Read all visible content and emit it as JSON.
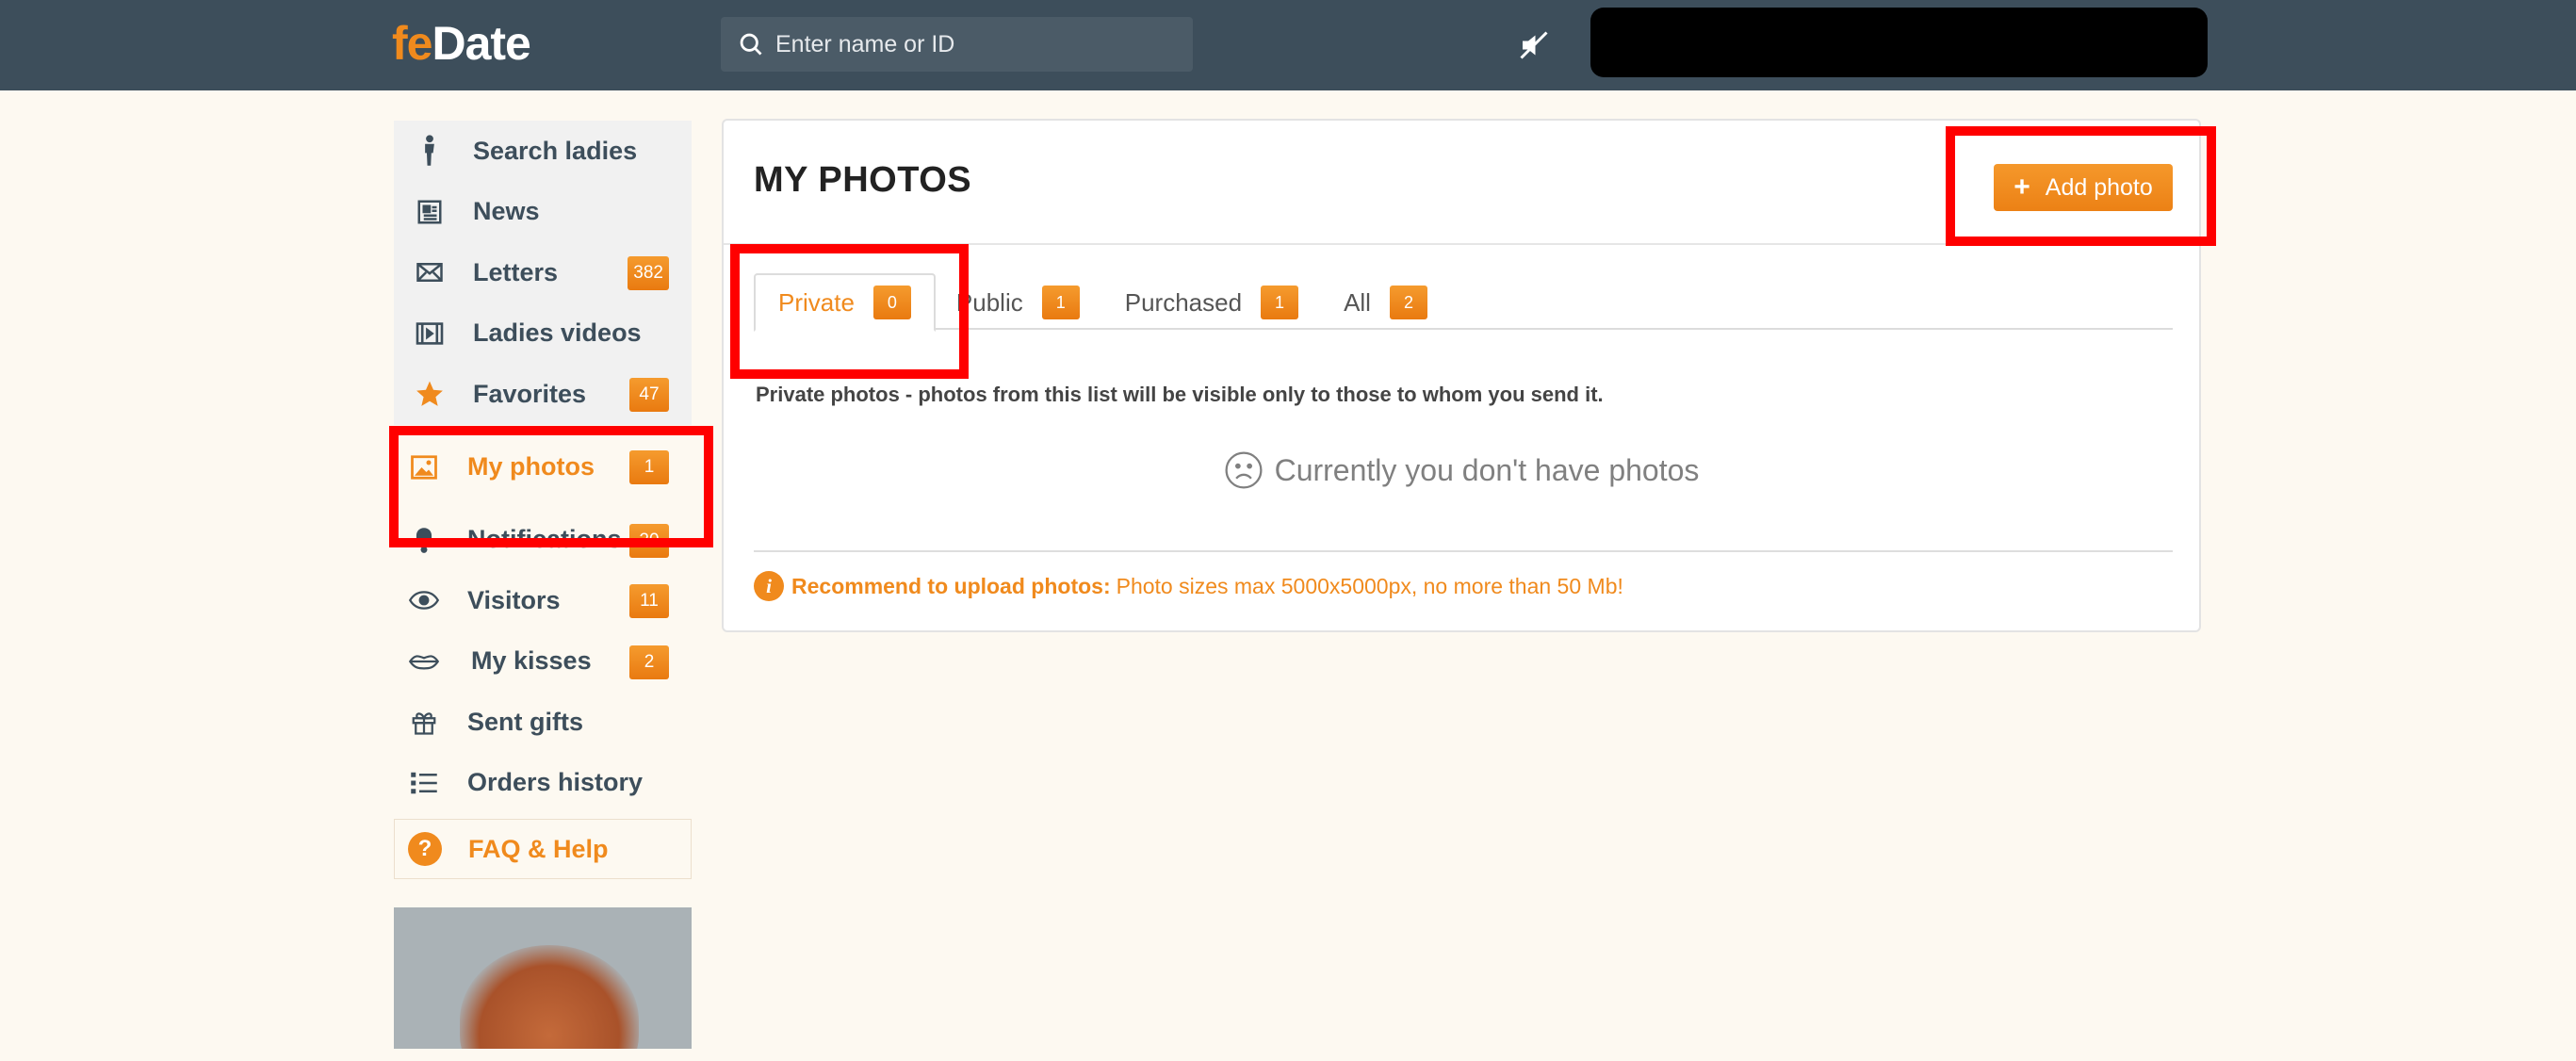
{
  "header": {
    "logo_fe": "fe",
    "logo_date": "Date",
    "search_placeholder": "Enter name or ID"
  },
  "sidebar": {
    "items": [
      {
        "label": "Search ladies",
        "icon": "person-icon"
      },
      {
        "label": "News",
        "icon": "newspaper-icon"
      },
      {
        "label": "Letters",
        "icon": "envelope-icon",
        "badge": "382"
      },
      {
        "label": "Ladies videos",
        "icon": "film-icon"
      },
      {
        "label": "Favorites",
        "icon": "star-icon",
        "badge": "47"
      },
      {
        "label": "My photos",
        "icon": "image-icon",
        "badge": "1",
        "active": true
      },
      {
        "label": "Notifications",
        "icon": "bell-icon",
        "badge": "20"
      },
      {
        "label": "Visitors",
        "icon": "eye-icon",
        "badge": "11"
      },
      {
        "label": "My kisses",
        "icon": "lips-icon",
        "badge": "2"
      },
      {
        "label": "Sent gifts",
        "icon": "gift-icon"
      },
      {
        "label": "Orders history",
        "icon": "list-icon"
      }
    ],
    "faq_label": "FAQ & Help",
    "faq_icon": "?"
  },
  "main": {
    "title": "MY PHOTOS",
    "add_button_label": "Add photo",
    "add_button_plus": "+",
    "tabs": [
      {
        "label": "Private",
        "count": "0",
        "active": true
      },
      {
        "label": "Public",
        "count": "1"
      },
      {
        "label": "Purchased",
        "count": "1"
      },
      {
        "label": "All",
        "count": "2"
      }
    ],
    "description": "Private photos - photos from this list will be visible only to those to whom you send it.",
    "empty_message": "Currently you don't have photos",
    "recommend_icon": "i",
    "recommend_title": "Recommend to upload photos:",
    "recommend_text": "Photo sizes max 5000x5000px, no more than 50 Mb!"
  },
  "colors": {
    "accent": "#f08a1d",
    "header_bg": "#3d4e5b",
    "page_bg": "#fdf9f1",
    "highlight": "#ff0000"
  }
}
